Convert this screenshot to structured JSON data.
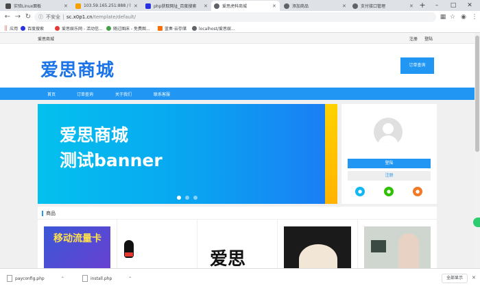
{
  "browser": {
    "tabs": [
      {
        "label": "实验Linux面板",
        "color": "#4a4a4a"
      },
      {
        "label": "103.59.165.251:888 / loc",
        "color": "#f4a100"
      },
      {
        "label": "php获取网址_百度搜索",
        "color": "#2932e1"
      },
      {
        "label": "爱思虎科商城",
        "color": "#5f6368"
      },
      {
        "label": "添加商品",
        "color": "#5f6368"
      },
      {
        "label": "支付接口管理",
        "color": "#5f6368"
      }
    ],
    "new_tab": "+",
    "window_controls": [
      "–",
      "□",
      "✕"
    ],
    "insecure_label": "不安全",
    "url_host": "sc.x0p1.cn",
    "url_path": "/template/default/",
    "bookmarks": [
      {
        "label": "应用",
        "color": "#5f6368"
      },
      {
        "label": "百度搜索",
        "color": "#2932e1"
      },
      {
        "label": "爱思娱乐网 - 活动信...",
        "color": "#e53935"
      },
      {
        "label": "随过图床 - 免费图...",
        "color": "#43a047"
      },
      {
        "label": "蓝奏·云存储",
        "color": "#ff6f00"
      },
      {
        "label": "localhost/爱思娱...",
        "color": "#5f6368"
      }
    ]
  },
  "site": {
    "topbar": {
      "site_name": "爱思商城",
      "register": "注册",
      "login": "登陆"
    },
    "logo": "爱思商城",
    "order_query_button": "订单查询",
    "nav": [
      "首页",
      "订单查询",
      "关于我们",
      "联系客服"
    ],
    "banner": {
      "line1": "爱思商城",
      "line2": "测试banner",
      "slides": 3,
      "active_slide": 0
    },
    "user_panel": {
      "login_button": "登陆",
      "register_button": "注册",
      "social": [
        "qq-icon",
        "wechat-icon",
        "weibo-icon"
      ]
    },
    "goods": {
      "title": "商品",
      "items": [
        {
          "caption": "移动流量卡"
        },
        {
          "caption": ""
        },
        {
          "caption": "爱思"
        },
        {
          "caption": ""
        },
        {
          "caption": ""
        }
      ]
    }
  },
  "downloads": {
    "files": [
      "payconfig.php",
      "install.php"
    ],
    "show_all": "全部显示"
  },
  "colors": {
    "accent": "#2196f3",
    "logo": "#1a74e8"
  }
}
